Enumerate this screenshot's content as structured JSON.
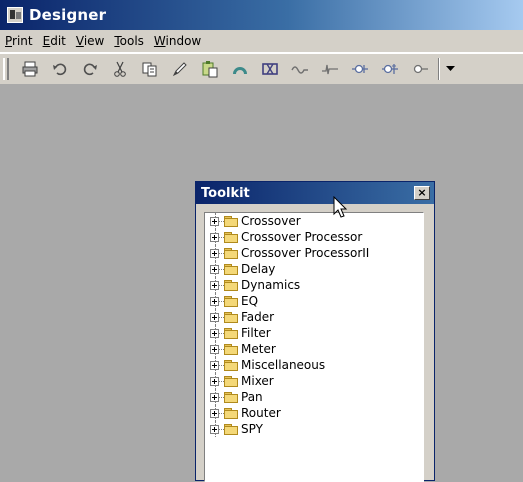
{
  "window": {
    "title": "Designer",
    "icon": "designer-app-icon"
  },
  "menu": [
    {
      "mnemonic": "P",
      "rest": "rint"
    },
    {
      "mnemonic": "E",
      "rest": "dit"
    },
    {
      "mnemonic": "V",
      "rest": "iew"
    },
    {
      "mnemonic": "T",
      "rest": "ools"
    },
    {
      "mnemonic": "W",
      "rest": "indow"
    }
  ],
  "toolbar": {
    "icons": [
      "print-icon",
      "undo-icon",
      "redo-icon",
      "cut-icon",
      "copy-icon",
      "pencil-icon",
      "paste-icon",
      "arch-icon",
      "block-icon",
      "wire-icon",
      "signal-icon",
      "node-icon",
      "split-node-icon",
      "connector-icon"
    ]
  },
  "toolkit": {
    "title": "Toolkit",
    "close_label": "×",
    "items": [
      "Crossover",
      "Crossover Processor",
      "Crossover ProcessorII",
      "Delay",
      "Dynamics",
      "EQ",
      "Fader",
      "Filter",
      "Meter",
      "Miscellaneous",
      "Mixer",
      "Pan",
      "Router",
      "SPY"
    ]
  }
}
